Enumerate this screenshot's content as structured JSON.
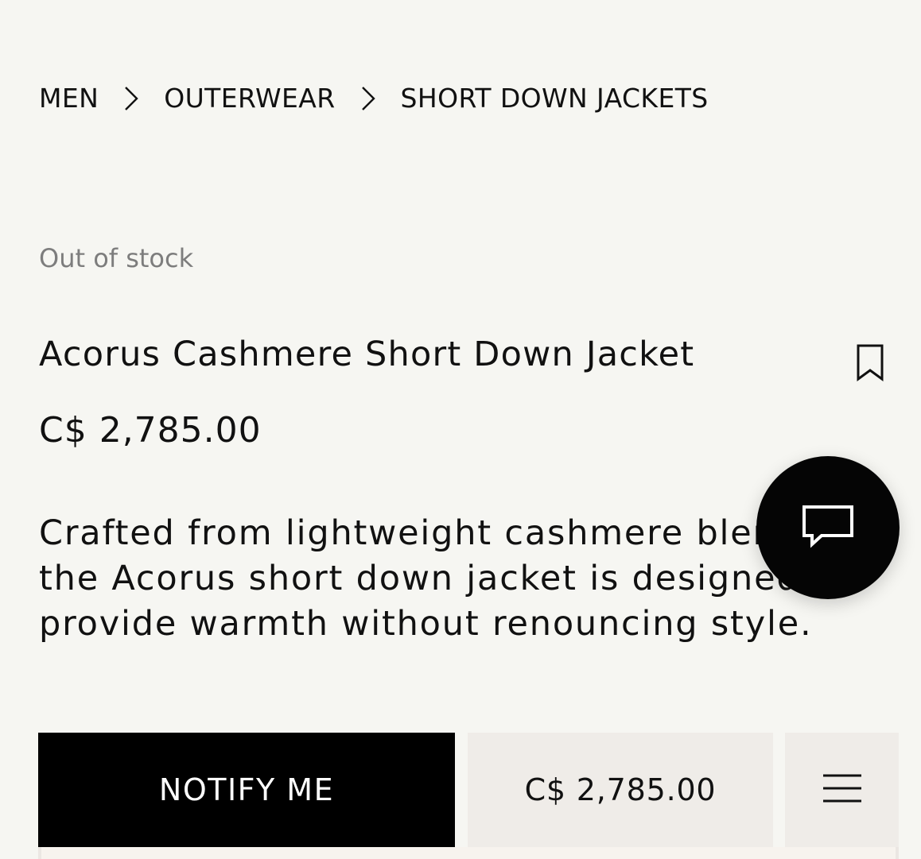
{
  "breadcrumb": {
    "items": [
      "MEN",
      "OUTERWEAR",
      "SHORT DOWN JACKETS"
    ],
    "separator_icon": "chevron-right-icon"
  },
  "product": {
    "availability": "Out of stock",
    "name": "Acorus Cashmere Short Down Jacket",
    "price": "C$ 2,785.00",
    "description": "Crafted from lightweight cashmere blend, the Acorus short down jacket is designed to provide warmth without renouncing style."
  },
  "actions": {
    "bookmark_icon": "bookmark-icon",
    "chat_icon": "chat-icon",
    "notify_label": "NOTIFY ME",
    "bottom_price": "C$ 2,785.00",
    "menu_icon": "menu-icon"
  },
  "colors": {
    "background": "#f6f6f2",
    "text": "#111111",
    "muted": "#7d7d7d",
    "button": "#000000",
    "panel": "#efece8"
  }
}
